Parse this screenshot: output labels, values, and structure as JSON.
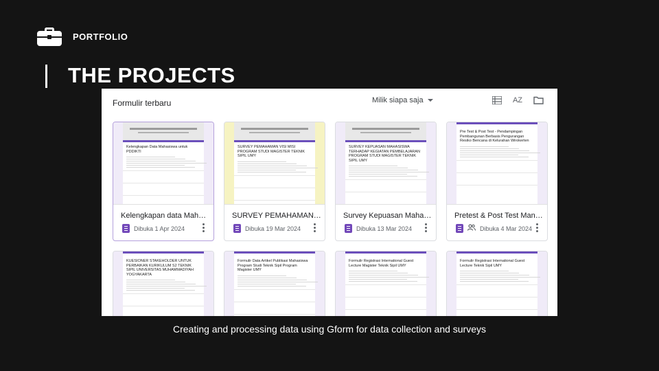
{
  "header": {
    "section_label": "PORTFOLIO",
    "title": "THE PROJECTS"
  },
  "drive": {
    "recent_label": "Formulir terbaru",
    "owner_filter": "Milik siapa saja",
    "view_icons": [
      "list-view-icon",
      "sort-az-icon",
      "folder-icon"
    ],
    "sort_label": "AZ",
    "cards": [
      {
        "title": "Kelengkapan data Mahasiswa untuk Pasca Sarjana",
        "thumb_title": "Kelengkapan Data Mahasiswa untuk PDDIKTI",
        "opened": "Dibuka 1 Apr 2024",
        "shared": false,
        "thumb": "lilac",
        "selected": true
      },
      {
        "title": "SURVEY PEMAHAMAN VISI MISI",
        "thumb_title": "SURVEY PEMAHAMAN VISI MISI PROGRAM STUDI MAGISTER TEKNIK SIPIL UMY",
        "opened": "Dibuka 19 Mar 2024",
        "shared": false,
        "thumb": "yellow",
        "selected": false
      },
      {
        "title": "Survey Kepuasan Mahasiswa",
        "thumb_title": "SURVEY KEPUASAN MAHASISWA TERHADAP KEGIATAN PEMBELAJARAN PROGRAM STUDI MAGISTER TEKNIK SIPIL UMY",
        "opened": "Dibuka 13 Mar 2024",
        "shared": false,
        "thumb": "lilac",
        "selected": false
      },
      {
        "title": "Pretest & Post Test Manajemen",
        "thumb_title": "Pre Test & Post Test - Pendampingan Pembangunan Berbasis Pengurangan Resiko Bencana di Kelurahan Wirokerten",
        "opened": "Dibuka 4 Mar 2024",
        "shared": true,
        "thumb": "lilac-plain",
        "selected": false
      },
      {
        "title": "",
        "thumb_title": "KUESIONER STAKEHOLDER UNTUK PERBAIKAN KURIKULUM S2 TEKNIK SIPIL UNIVERSITAS MUHAMMADIYAH YOGYAKARTA",
        "opened": "",
        "shared": false,
        "thumb": "lilac-plain",
        "selected": false
      },
      {
        "title": "",
        "thumb_title": "Formulir Data Artikel Publikasi Mahasiswa Program Studi Teknik Sipil Program Magister UMY",
        "opened": "",
        "shared": false,
        "thumb": "lilac-plain",
        "selected": false
      },
      {
        "title": "",
        "thumb_title": "Formulir Registrasi International Guest Lecture Magister Teknik Sipil UMY",
        "opened": "",
        "shared": false,
        "thumb": "lilac-plain",
        "selected": false
      },
      {
        "title": "",
        "thumb_title": "Formulir Registrasi International Guest Lecture Teknik Sipil UMY",
        "opened": "",
        "shared": false,
        "thumb": "lilac-plain",
        "selected": false
      }
    ]
  },
  "caption": "Creating and processing data using Gform for data collection and surveys"
}
